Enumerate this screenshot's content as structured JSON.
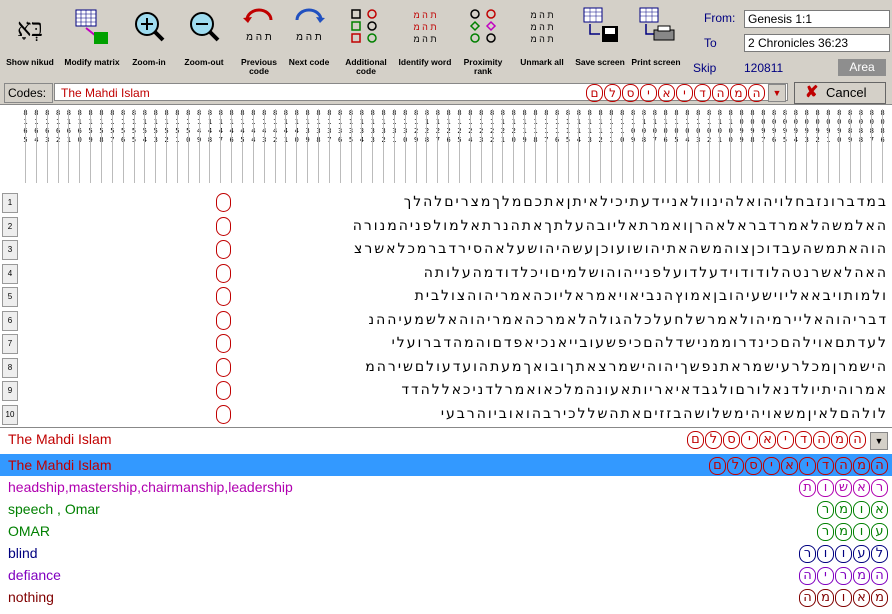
{
  "toolbar": {
    "buttons": [
      {
        "label": "Show nikud",
        "icon": "hebrew-letters-icon"
      },
      {
        "label": "Modify matrix",
        "icon": "grid-arrow-icon"
      },
      {
        "label": "Zoom-in",
        "icon": "zoom-in-icon"
      },
      {
        "label": "Zoom-out",
        "icon": "zoom-out-icon"
      },
      {
        "label": "Previous code",
        "icon": "previous-code-icon"
      },
      {
        "label": "Next code",
        "icon": "next-code-icon"
      },
      {
        "label": "Additional code",
        "icon": "additional-code-icon"
      },
      {
        "label": "Identify word",
        "icon": "identify-word-icon"
      },
      {
        "label": "Proximity rank",
        "icon": "proximity-rank-icon"
      },
      {
        "label": "Unmark all",
        "icon": "unmark-all-icon"
      },
      {
        "label": "Save screen",
        "icon": "save-screen-icon"
      },
      {
        "label": "Print screen",
        "icon": "print-screen-icon"
      }
    ],
    "from_label": "From:",
    "from_value": "Genesis 1:1",
    "to_label": "To",
    "to_value": "2 Chronicles 36:23",
    "skip_label": "Skip",
    "skip_value": "120811",
    "area_label": "Area"
  },
  "codes": {
    "label": "Codes:",
    "value": "The Mahdi Islam",
    "hebrew": "המהדיאיסלם",
    "cancel_label": "Cancel"
  },
  "columns": [
    "8165",
    "8164",
    "8163",
    "8162",
    "8161",
    "8160",
    "8159",
    "8158",
    "8157",
    "8156",
    "8155",
    "8154",
    "8153",
    "8152",
    "8151",
    "8150",
    "8149",
    "8148",
    "8147",
    "8146",
    "8145",
    "8144",
    "8143",
    "8142",
    "8141",
    "8140",
    "8139",
    "8138",
    "8137",
    "8136",
    "8135",
    "8134",
    "8133",
    "8132",
    "8131",
    "8130",
    "8129",
    "8128",
    "8127",
    "8126",
    "8125",
    "8124",
    "8123",
    "8122",
    "8121",
    "8120",
    "8119",
    "8118",
    "8117",
    "8116",
    "8115",
    "8114",
    "8113",
    "8112",
    "8111",
    "8110",
    "8109",
    "8108",
    "8107",
    "8106",
    "8105",
    "8104",
    "8103",
    "8102",
    "8101",
    "8100",
    "8099",
    "8098",
    "8097",
    "8096",
    "8095",
    "8094",
    "8093",
    "8092",
    "8091",
    "8090",
    "8089",
    "8088",
    "8087",
    "8086"
  ],
  "matrix_rows": [
    {
      "num": "1",
      "text": "במדברונזבחלויהואלהינוולאניידעתיכילאיתןאתכםמלךמצריםלהלך"
    },
    {
      "num": "2",
      "text": "האלמשהלאמרדבראלאהרןואמרתאליובהעלתךאתהנרתאלמולפניהמנורה"
    },
    {
      "num": "3",
      "text": "הוהאתמשהעבדוכןצוהמשהאתיהושועוכןעשהיהושעלאהסירדברמכלאשרצ"
    },
    {
      "num": "4",
      "text": "האהלאשרנטהלודודוידעלדועלפנייהוהושלמיםויכלדודמהעלותה"
    },
    {
      "num": "5",
      "text": "ולמותויבאאליוישעיהובןאמוץהנביאויאמראליוכהאמריהוהצולבית"
    },
    {
      "num": "6",
      "text": "דבריהוהאליירמיהולאמרשלחעלכלהגולהלאמרכהאמריהוהאלשמעיההנ"
    },
    {
      "num": "7",
      "text": "לעדתםאוילהםכינדרוממנישדלהםכיפשעובייאנכיאפדםוהמהדברועלי"
    },
    {
      "num": "8",
      "text": "הישמרןמכלרעישמראתנפשךיהוהישמרצאתךובואךמעתהועדעולםשירהמ"
    },
    {
      "num": "9",
      "text": "אמרוהיתיולדנאלורםולגבדאיאריותאעונהמלכאואמרלדניכאללהדד"
    },
    {
      "num": "10",
      "text": "לולהםלאיןמשאויהימשלושהבזזיםאתהשללכירבהואוביוהרבעי"
    }
  ],
  "search": {
    "value": "The Mahdi Islam",
    "hebrew": "המהדיאיסלם"
  },
  "results": [
    {
      "label": "The Mahdi Islam",
      "hebrew": "המהדיאיסלם",
      "color": "#c00000",
      "selected": true
    },
    {
      "label": "headship,mastership,chairmanship,leadership",
      "hebrew": "ראשות",
      "color": "#b000b0",
      "selected": false
    },
    {
      "label": "speech , Omar",
      "hebrew": "אומר",
      "color": "#008000",
      "selected": false
    },
    {
      "label": "OMAR",
      "hebrew": "עומר",
      "color": "#008000",
      "selected": false
    },
    {
      "label": "blind",
      "hebrew": "לעוור",
      "color": "#000080",
      "selected": false
    },
    {
      "label": "defiance",
      "hebrew": "המריה",
      "color": "#8000c0",
      "selected": false
    },
    {
      "label": "nothing",
      "hebrew": "מאומה",
      "color": "#800000",
      "selected": false
    }
  ]
}
